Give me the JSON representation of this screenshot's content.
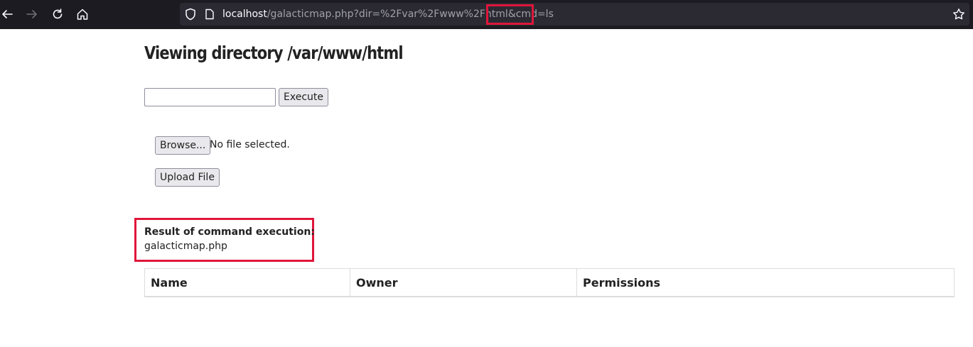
{
  "browser": {
    "url_host": "localhost",
    "url_path": "/galacticmap.php?dir=%2Fvar%2Fwww%2Fhtml",
    "url_cmd": "&cmd=ls",
    "accent_color": "#e0163b"
  },
  "page": {
    "title": "Viewing directory /var/www/html",
    "command_input_value": "",
    "execute_label": "Execute",
    "browse_label": "Browse...",
    "file_status": "No file selected.",
    "upload_label": "Upload File",
    "result_label": "Result of command execution:",
    "result_value": "galacticmap.php"
  },
  "table": {
    "headers": [
      "Name",
      "Owner",
      "Permissions"
    ]
  }
}
